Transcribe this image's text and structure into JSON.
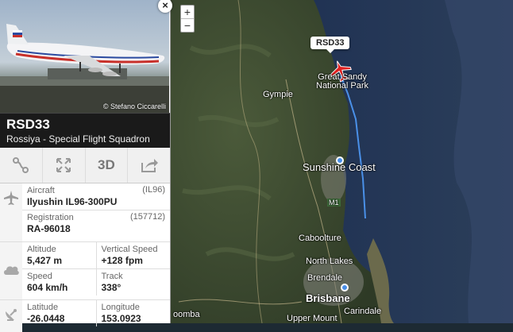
{
  "map": {
    "zoom_in": "+",
    "zoom_out": "−",
    "flight_tag": "RSD33",
    "labels": {
      "park": "Great Sandy\nNational Park",
      "gympie": "Gympie",
      "sunshine_coast": "Sunshine Coast",
      "m1": "M1",
      "caboolture": "Caboolture",
      "north_lakes": "North Lakes",
      "brendale": "Brendale",
      "brisbane": "Brisbane",
      "carindale": "Carindale",
      "upper_mount": "Upper Mount",
      "toowoomba_partial": "oomba"
    },
    "colors": {
      "sea": "#1d2e4a",
      "land": "#3a4a30",
      "track": "#4a90e8",
      "plane": "#e02020"
    }
  },
  "photo": {
    "credit": "© Stefano Ciccarelli"
  },
  "close_label": "×",
  "flight": {
    "callsign": "RSD33",
    "airline": "Rossiya - Special Flight Squadron"
  },
  "actions": {
    "route_icon": "route-icon",
    "expand_icon": "expand-arrows-icon",
    "three_d": "3D",
    "share_icon": "share-icon"
  },
  "details": {
    "aircraft_label": "Aircraft",
    "aircraft_code": "(IL96)",
    "aircraft_value": "Ilyushin IL96-300PU",
    "registration_label": "Registration",
    "registration_code": "(157712)",
    "registration_value": "RA-96018",
    "altitude_label": "Altitude",
    "altitude_value": "5,427 m",
    "vspeed_label": "Vertical Speed",
    "vspeed_value": "+128 fpm",
    "speed_label": "Speed",
    "speed_value": "604 km/h",
    "track_label": "Track",
    "track_value": "338°",
    "latitude_label": "Latitude",
    "latitude_value": "-26.0448",
    "longitude_label": "Longitude",
    "longitude_value": "153.0923"
  }
}
